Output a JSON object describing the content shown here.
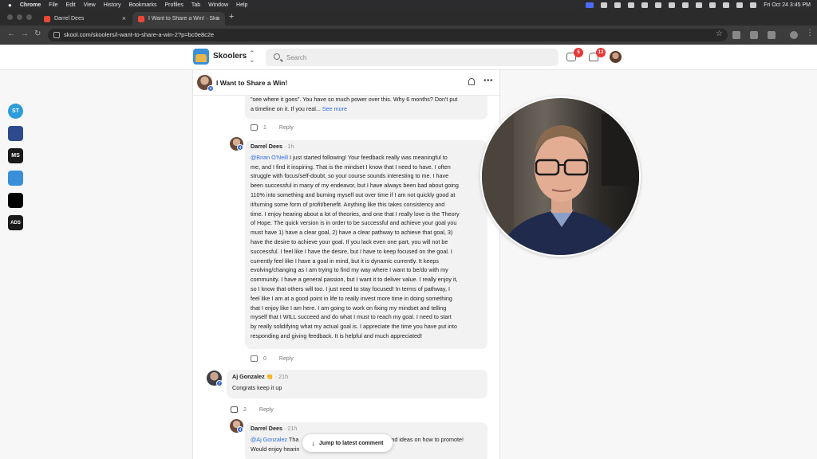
{
  "menubar": {
    "app": "Chrome",
    "items": [
      "File",
      "Edit",
      "View",
      "History",
      "Bookmarks",
      "Profiles",
      "Tab",
      "Window",
      "Help"
    ],
    "clock": "Fri Oct 24  3:45 PM"
  },
  "tabs": [
    {
      "title": "Darrel Dees"
    },
    {
      "title": "I Want to Share a Win! · Skoo"
    }
  ],
  "address": {
    "url": "skool.com/skoolers/i-want-to-share-a-win-2?p=bc0e8c2e"
  },
  "header": {
    "brand": "Skoolers",
    "search_placeholder": "Search",
    "chat_badge": "5",
    "notif_badge": "13"
  },
  "rail": {
    "items": [
      {
        "label": "ST",
        "color": "#2d9cdb"
      },
      {
        "label": "",
        "color": "#2c4a8c"
      },
      {
        "label": "MS",
        "color": "#1a1a1a"
      },
      {
        "label": "",
        "color": "#3a8fd9"
      },
      {
        "label": "",
        "color": "#000000"
      },
      {
        "label": "ADS",
        "color": "#1a1a1a"
      }
    ]
  },
  "post": {
    "title": "I Want to Share a Win!",
    "c0": {
      "text1": "\"see where it goes\". You have so much power over this. Why 6 months? Don't put",
      "text2": "a timeline on it. If you real...",
      "see_more": "See more",
      "likes": "1",
      "reply": "Reply"
    },
    "c1": {
      "author": "Darrel Dees",
      "meta": " · 1h",
      "mention": "@Brian O'Neill",
      "lines": [
        " I just started following! Your feedback really was meaningful to",
        "me, and I find it inspiring. That is the mindset I know that I need to have. I often",
        "struggle with focus/self-doubt, so your course sounds interesting to me. I have",
        "been successful in many of my endeavor, but I have always been bad about going",
        "110% into something and burning myself out over time if I am not quickly good at",
        "it/turning some form of profit/benefit. Anything like this takes consistency and",
        "time. I enjoy hearing about a lot of theories, and one that I really love is the Theory",
        "of Hope. The quick version is in order to be successful and achieve your goal you",
        "must have 1) have a clear goal, 2) have a clear pathway to achieve that goal, 3)",
        "have the desire to achieve your goal. If you lack even one part, you will not be",
        "successful. I feel like I have the desire, but I have to keep focused on the goal. I",
        "currently feel like I have a goal in mind, but it is dynamic currently. It keeps",
        "evolving/changing as I am trying to find my way where I want to be/do with my",
        "community. I have a general passion, but I want it to deliver value. I really enjoy it,",
        "so I know that others will too. I just need to stay focused! In terms of pathway, I",
        "feel like I am at a good point in life to really invest more time in doing something",
        "that I enjoy like I am here. I am going to work on fixing my mindset and telling",
        "myself that I WILL succeed and do what I must to reach my goal. I need to start",
        "by really solidifying what my actual goal is. I appreciate the time you have put into",
        "responding and giving feedback. It is helpful and much appreciated!"
      ],
      "likes": "0",
      "reply": "Reply",
      "level": "4"
    },
    "c2": {
      "author": "Aj Gonzalez",
      "emoji": "👏",
      "meta": " · 21h",
      "text": "Congrats keep it up",
      "likes": "2",
      "reply": "Reply",
      "level": "7"
    },
    "c3": {
      "author": "Darrel Dees",
      "meta": " · 21h",
      "mention": "@Aj Gonzalez",
      "text_a": " Tha",
      "text_b": "nd ideas on how to promote!",
      "text_c": "Would enjoy hearin",
      "level": "4"
    },
    "jump": "Jump to latest comment",
    "post_level": "4"
  }
}
